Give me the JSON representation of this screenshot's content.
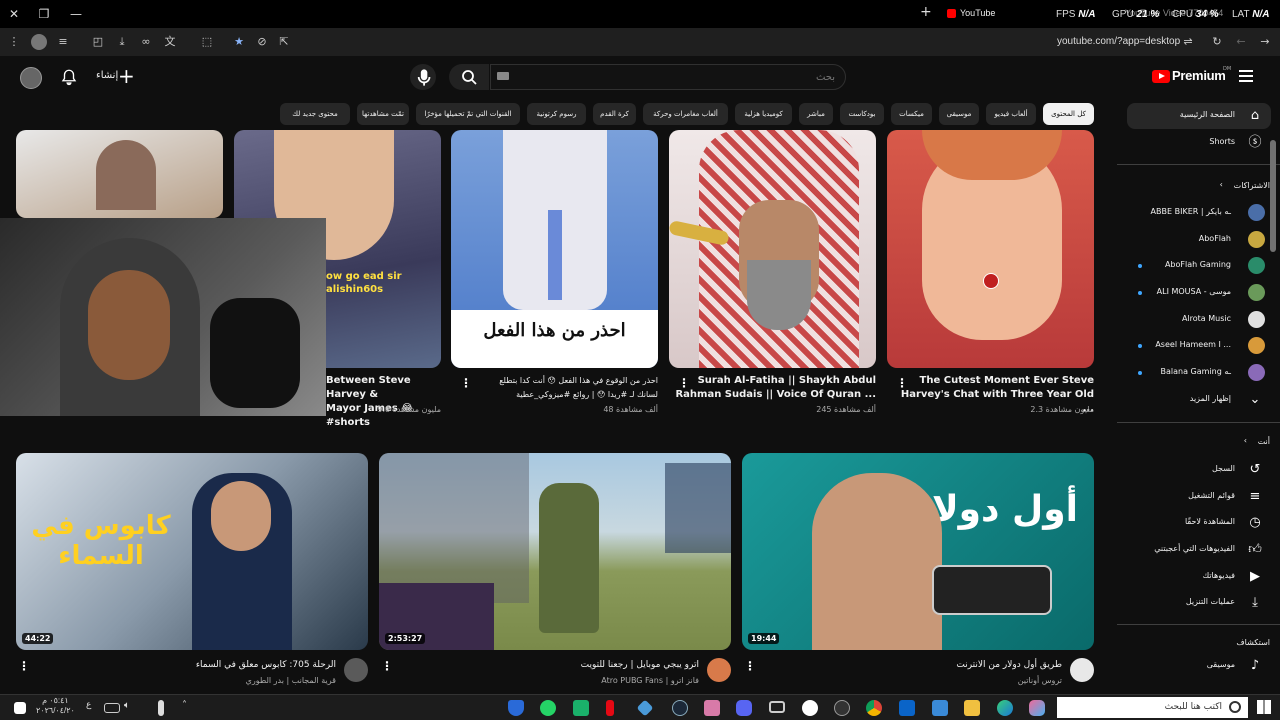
{
  "window": {
    "tab_title": "YouTube",
    "perf_fps_label": "FPS",
    "perf_fps": "N/A",
    "perf_gpu_label": "GPU",
    "perf_gpu": "21 %",
    "perf_cpu_label": "CPU",
    "perf_cpu": "34 %",
    "perf_lat_label": "LAT",
    "perf_lat": "N/A",
    "ghost_title": "YouTube Video 7700454"
  },
  "address_bar": {
    "url": "youtube.com/?app=desktop"
  },
  "header": {
    "create_label": "إنشاء",
    "search_placeholder": "بحث",
    "logo_text": "Premium",
    "logo_sup": "DM"
  },
  "chips": [
    {
      "label": "كل المحتوى",
      "active": true
    },
    {
      "label": "ألعاب فيديو"
    },
    {
      "label": "موسيقى"
    },
    {
      "label": "ميكسات"
    },
    {
      "label": "بودكاست"
    },
    {
      "label": "مباشر"
    },
    {
      "label": "كوميديا هزلية"
    },
    {
      "label": "ألعاب مغامرات وحركة"
    },
    {
      "label": "كرة القدم"
    },
    {
      "label": "رسوم كرتونية"
    },
    {
      "label": "القنوات التي تمّ تحميلها مؤخرًا"
    },
    {
      "label": "تمّت مشاهدتها"
    },
    {
      "label": "محتوى جديد لك"
    }
  ],
  "sidebar": {
    "home": "الصفحة الرئيسية",
    "shorts": "Shorts",
    "subscriptions": "الاشتراكات",
    "subs": [
      {
        "name": "ABBE BIKER | ـه بايكر",
        "color": "#4a6ea8",
        "dot": false
      },
      {
        "name": "AboFlah",
        "color": "#c8a840",
        "dot": false
      },
      {
        "name": "AboFlah Gaming",
        "color": "#2a8c6a",
        "dot": true
      },
      {
        "name": "ALI MOUSA - موسى",
        "color": "#6a9a5a",
        "dot": true
      },
      {
        "name": "Alrota Music",
        "color": "#e0e0e0",
        "dot": false
      },
      {
        "name": "Aseel Hameem I ...",
        "color": "#d89a3a",
        "dot": true
      },
      {
        "name": "Balana Gaming ـه",
        "color": "#8a6ab8",
        "dot": true
      }
    ],
    "show_more": "إظهار المزيد",
    "you": "أنت",
    "you_items": [
      "السجل",
      "قوائم التشغيل",
      "المشاهدة لاحقًا",
      "الفيديوهات التي أعجبتني",
      "فيديوهاتك",
      "عمليات التنزيل"
    ],
    "explore": "استكشاف",
    "music": "موسيقى"
  },
  "shorts": [
    {
      "title_1": "The Cutest Moment Ever Steve",
      "title_2": "Harvey's Chat with Three Year Old ...",
      "views": "2.3 مليون مشاهدة",
      "overlay": "",
      "bg": "#c04a3a"
    },
    {
      "title_1": "Surah Al-Fatiha || Shaykh Abdul",
      "title_2": "Rahman Sudais || Voice Of Quran ...",
      "views": "245 ألف مشاهدة",
      "overlay": "",
      "bg": "#8a3a3a"
    },
    {
      "title_1": "احذر من الوقوع في هذا الفعل 😯 أنت كدا بتطلع",
      "title_2": "لسانك لـ #ريدا 😯 | روائع #ميزوكي_عطية",
      "views": "48 ألف مشاهدة",
      "overlay": "احذر من هذا الفعل",
      "bg": "#6a8aca"
    },
    {
      "title_1": "Between Steve Harvey &",
      "title_2": "Mayor James 😂 #shorts",
      "views": "9.8 مليون مشاهدة",
      "overlay": "ow go ead sir alishin60s",
      "bg": "#5a5a7a"
    }
  ],
  "videos": [
    {
      "title": "طريق أول دولار من الانترنت",
      "channel": "تروس أوناتين",
      "duration": "19:44",
      "overlay": "أول دولار",
      "bg": "#1a8a8a",
      "avatar": "#e8e8e8"
    },
    {
      "title": "اترو يبجي موبايل | رجعنا للتويت",
      "channel": "Atro PUBG Fans | فانز اترو",
      "duration": "2:53:27",
      "overlay": "",
      "bg": "#4a6a8a",
      "avatar": "#d87a4a"
    },
    {
      "title": "الرحلة 705: كابوس معلق في السماء",
      "channel": "قرية المجانب | بدر الطوري",
      "duration": "44:22",
      "overlay": "كابوس في السماء",
      "bg": "#3a5a7a",
      "avatar": "#5a5a5a"
    }
  ],
  "taskbar": {
    "search_placeholder": "اكتب هنا للبحث",
    "time": "٠٥:٤١ م",
    "date": "٢٠٢٦/٠٤/٢٠",
    "lang": "ع"
  }
}
